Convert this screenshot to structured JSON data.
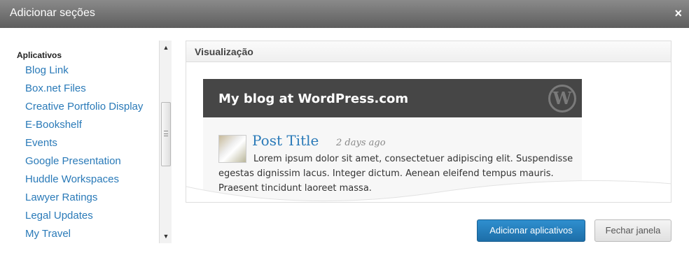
{
  "dialog": {
    "title": "Adicionar seções",
    "close_glyph": "×"
  },
  "sidebar": {
    "group_label": "Aplicativos",
    "items": [
      "Blog Link",
      "Box.net Files",
      "Creative Portfolio Display",
      "E-Bookshelf",
      "Events",
      "Google Presentation",
      "Huddle Workspaces",
      "Lawyer Ratings",
      "Legal Updates",
      "My Travel"
    ]
  },
  "preview": {
    "header": "Visualização",
    "blog_title": "My blog at WordPress.com",
    "logo_letter": "W",
    "post_title": "Post Title",
    "post_date": "2 days ago",
    "excerpt": "Lorem ipsum dolor sit amet, consectetuer adipiscing elit. Suspendisse egestas dignissim lacus. Integer dictum. Aenean eleifend tempus mauris. Praesent tincidunt laoreet massa."
  },
  "buttons": {
    "add": "Adicionar aplicativos",
    "close": "Fechar janela"
  },
  "colors": {
    "link": "#2a7ab8",
    "primary_button": "#1d6ea8",
    "blog_header": "#464646"
  }
}
